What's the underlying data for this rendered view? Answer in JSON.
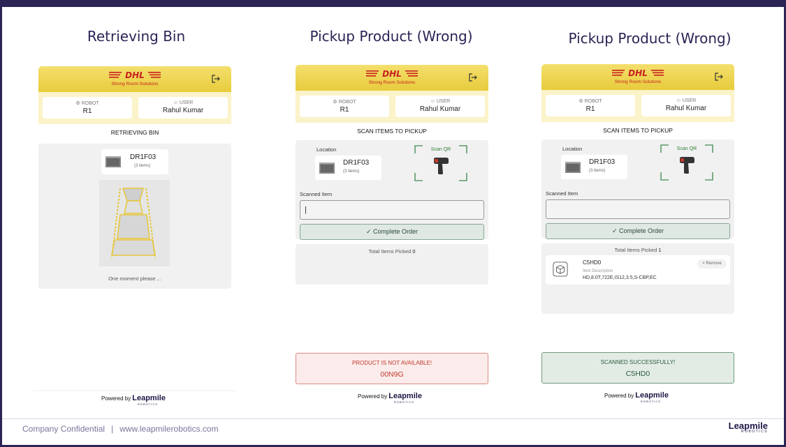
{
  "footer": {
    "confidential": "Company Confidential",
    "separator": "|",
    "website": "www.leapmilerobotics.com",
    "logo_text": "Leapmile",
    "logo_sub": "ROBOTICS"
  },
  "panels": [
    {
      "title": "Retrieving Bin",
      "header": {
        "subtitle": "Strong Room Solutions"
      },
      "robot": {
        "label": "ROBOT",
        "value": "R1"
      },
      "user": {
        "label": "USER",
        "value": "Rahul Kumar"
      },
      "section_title": "RETRIEVING BIN",
      "bin": {
        "id": "DR1F03",
        "count": "(3 items)"
      },
      "message": "One moment please ...",
      "powered_by": "Powered by",
      "brand": "Leapmile",
      "brand_sub": "ROBOTICS"
    },
    {
      "title": "Pickup Product (Wrong)",
      "header": {
        "subtitle": "Strong Room Solutions"
      },
      "robot": {
        "label": "ROBOT",
        "value": "R1"
      },
      "user": {
        "label": "USER",
        "value": "Rahul Kumar"
      },
      "section_title": "SCAN ITEMS TO PICKUP",
      "location_label": "Location",
      "bin": {
        "id": "DR1F03",
        "count": "(3 items)"
      },
      "scan_qr": "Scan QR",
      "scanned_label": "Scanned Item",
      "scanned_value": "|",
      "complete_btn": "✓ Complete Order",
      "total_label": "Total Items Picked",
      "total_value": "0",
      "status": {
        "title": "PRODUCT IS NOT AVAILABLE!",
        "code": "00N9G",
        "type": "error"
      },
      "powered_by": "Powered by",
      "brand": "Leapmile",
      "brand_sub": "ROBOTICS"
    },
    {
      "title": "Pickup Product (Wrong)",
      "header": {
        "subtitle": "Strong Room Solutions"
      },
      "robot": {
        "label": "ROBOT",
        "value": "R1"
      },
      "user": {
        "label": "USER",
        "value": "Rahul Kumar"
      },
      "section_title": "SCAN ITEMS TO PICKUP",
      "location_label": "Location",
      "bin": {
        "id": "DR1F03",
        "count": "(3 items)"
      },
      "scan_qr": "Scan QR",
      "scanned_label": "Scanned Item",
      "scanned_value": "",
      "complete_btn": "✓ Complete Order",
      "total_label": "Total Items Picked",
      "total_value": "1",
      "item": {
        "id": "C5HD0",
        "desc_label": "Item Description",
        "desc": "HD,8.0T,722E,IS12,3.5,S-CBP,EC",
        "remove": "× Remove"
      },
      "status": {
        "title": "SCANNED SUCCESSFULLY!",
        "code": "C5HD0",
        "type": "success"
      },
      "powered_by": "Powered by",
      "brand": "Leapmile",
      "brand_sub": "ROBOTICS"
    }
  ],
  "colors": {
    "frame": "#2b2455",
    "dhl_yellow": "#e7cc3c",
    "dhl_red": "#c8201e",
    "error_bg": "#fbeceb",
    "error_border": "#d98a84",
    "error_text": "#c0392b",
    "success_bg": "#e2ece5",
    "success_border": "#6e9a7c",
    "success_text": "#2c5a3c"
  }
}
